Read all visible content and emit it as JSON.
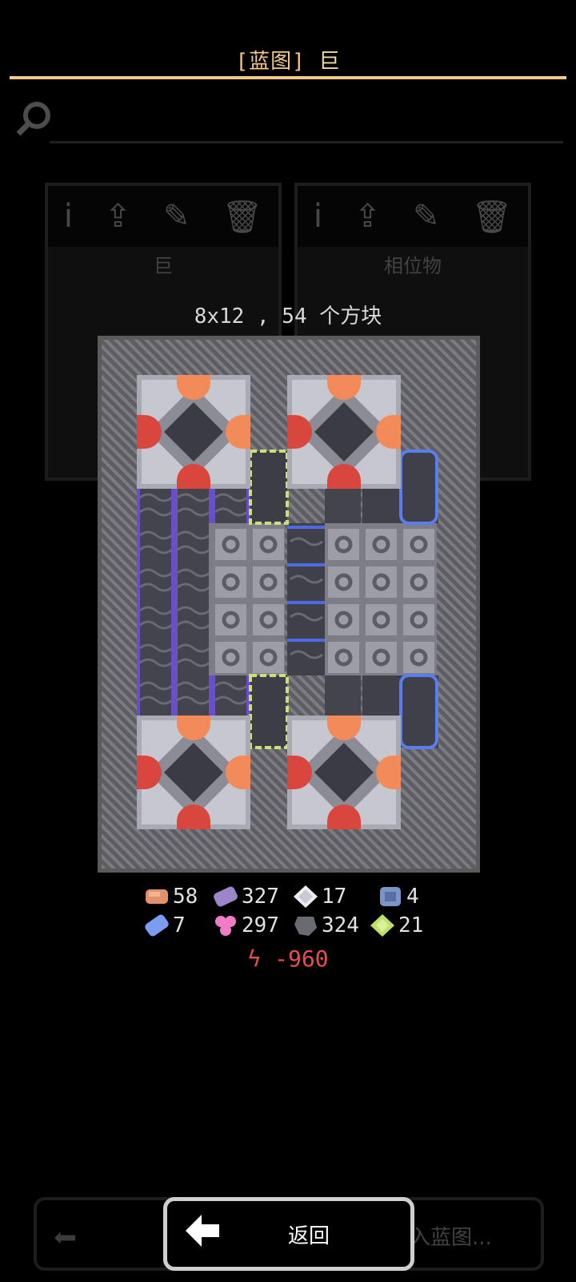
{
  "header": {
    "title_bracket": "[蓝图]",
    "title_name": "巨"
  },
  "background": {
    "search_icon": "search-icon",
    "cards": [
      {
        "name": "巨",
        "actions": [
          "info-icon",
          "upload-icon",
          "edit-icon",
          "delete-icon"
        ]
      },
      {
        "name": "相位物",
        "actions": [
          "info-icon",
          "upload-icon",
          "edit-icon",
          "delete-icon"
        ]
      }
    ],
    "import_button_label": "入蓝图..."
  },
  "popup": {
    "size_text": "8x12 , 54 个方块",
    "resources_row1": [
      {
        "icon": "copper-icon",
        "value": "58"
      },
      {
        "icon": "phase-fabric-icon",
        "value": "327"
      },
      {
        "icon": "metaglass-icon",
        "value": "17"
      },
      {
        "icon": "titanium-icon",
        "value": "4"
      }
    ],
    "resources_row2": [
      {
        "icon": "plastanium-icon",
        "value": "7"
      },
      {
        "icon": "spore-pod-icon",
        "value": "297"
      },
      {
        "icon": "lead-icon",
        "value": "324"
      },
      {
        "icon": "surge-alloy-icon",
        "value": "21"
      }
    ],
    "power_icon": "lightning-icon",
    "power_text": "-960"
  },
  "footer": {
    "back_label": "返回",
    "back_icon": "arrow-left-icon"
  },
  "colors": {
    "accent": "#f3c889",
    "power": "#e35050"
  }
}
